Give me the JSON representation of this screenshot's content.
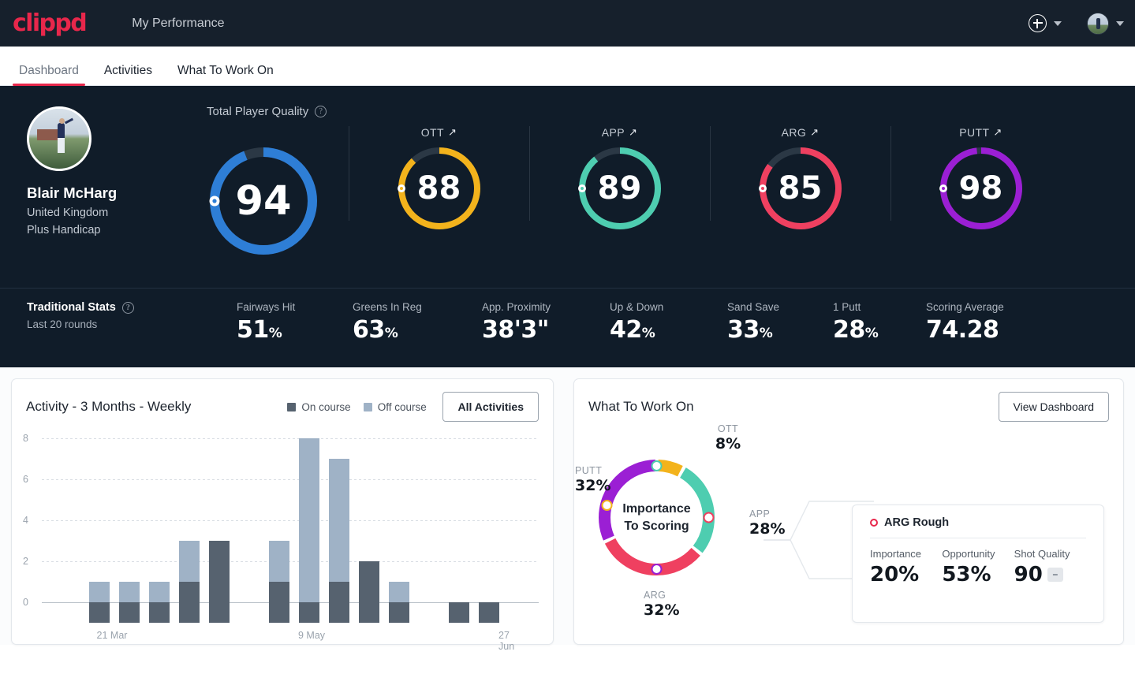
{
  "brand": {
    "logo_text": "clippd",
    "accent": "#e8274b"
  },
  "header": {
    "app_title": "My Performance",
    "add_icon": "plus-circle-icon",
    "add_caret": "chevron-down-icon",
    "avatar_caret": "chevron-down-icon"
  },
  "tabs": [
    {
      "label": "Dashboard",
      "active": true
    },
    {
      "label": "Activities",
      "active": false
    },
    {
      "label": "What To Work On",
      "active": false
    }
  ],
  "profile": {
    "name": "Blair McHarg",
    "country": "United Kingdom",
    "handicap": "Plus Handicap"
  },
  "quality": {
    "section_label": "Total Player Quality",
    "help_icon": "question-mark-icon",
    "total": {
      "label": "Total Player Quality",
      "value": "94",
      "percent": 94,
      "color": "#2e7ed6"
    },
    "skills": [
      {
        "label": "OTT",
        "trend": "↗",
        "value": "88",
        "percent": 88,
        "color": "#f3b31c"
      },
      {
        "label": "APP",
        "trend": "↗",
        "value": "89",
        "percent": 89,
        "color": "#4ecdb0"
      },
      {
        "label": "ARG",
        "trend": "↗",
        "value": "85",
        "percent": 85,
        "color": "#ef4060"
      },
      {
        "label": "PUTT",
        "trend": "↗",
        "value": "98",
        "percent": 98,
        "color": "#9b1fd4"
      }
    ]
  },
  "traditional": {
    "title": "Traditional Stats",
    "help_icon": "question-mark-icon",
    "subtitle": "Last 20 rounds",
    "stats": [
      {
        "label": "Fairways Hit",
        "value": "51",
        "unit": "%"
      },
      {
        "label": "Greens In Reg",
        "value": "63",
        "unit": "%"
      },
      {
        "label": "App. Proximity",
        "value": "38'3\"",
        "unit": ""
      },
      {
        "label": "Up & Down",
        "value": "42",
        "unit": "%"
      },
      {
        "label": "Sand Save",
        "value": "33",
        "unit": "%"
      },
      {
        "label": "1 Putt",
        "value": "28",
        "unit": "%"
      },
      {
        "label": "Scoring Average",
        "value": "74.28",
        "unit": ""
      }
    ]
  },
  "activity": {
    "title": "Activity - 3 Months - Weekly",
    "legend": [
      {
        "label": "On course",
        "color": "#56626f"
      },
      {
        "label": "Off course",
        "color": "#9fb2c6"
      }
    ],
    "button": "All Activities"
  },
  "chart_data": {
    "type": "bar",
    "title": "Activity - 3 Months - Weekly",
    "stacked": true,
    "xlabel": "",
    "ylabel": "",
    "ylim": [
      0,
      9
    ],
    "yticks": [
      0,
      2,
      4,
      6,
      8
    ],
    "grid": true,
    "legend_position": "top-right",
    "categories": [
      "21 Mar",
      "28 Mar",
      "4 Apr",
      "11 Apr",
      "18 Apr",
      "25 Apr",
      "2 May",
      "9 May",
      "16 May",
      "23 May",
      "30 May",
      "6 Jun",
      "13 Jun",
      "20 Jun",
      "27 Jun",
      "4 Jul"
    ],
    "xtick_labels": [
      {
        "category": "21 Mar",
        "index": 0
      },
      {
        "category": "9 May",
        "index": 7
      },
      {
        "category": "27 Jun",
        "index": 14
      }
    ],
    "series": [
      {
        "name": "On course",
        "color": "#56626f",
        "values": [
          1,
          1,
          1,
          2,
          4,
          0,
          2,
          1,
          2,
          3,
          1,
          0,
          1,
          1,
          0,
          0
        ]
      },
      {
        "name": "Off course",
        "color": "#9fb2c6",
        "values": [
          1,
          1,
          1,
          2,
          0,
          0,
          2,
          8,
          6,
          0,
          1,
          0,
          0,
          0,
          0,
          0
        ]
      }
    ]
  },
  "wtwo": {
    "title": "What To Work On",
    "button": "View Dashboard",
    "donut_center_line1": "Importance",
    "donut_center_line2": "To Scoring",
    "segments": [
      {
        "label": "OTT",
        "value": "8%",
        "percent": 8,
        "color": "#f3b31c"
      },
      {
        "label": "APP",
        "value": "28%",
        "percent": 28,
        "color": "#4ecdb0"
      },
      {
        "label": "ARG",
        "value": "32%",
        "percent": 32,
        "color": "#ef4060"
      },
      {
        "label": "PUTT",
        "value": "32%",
        "percent": 32,
        "color": "#9b1fd4"
      }
    ],
    "detail": {
      "marker_icon": "ring-marker-icon",
      "title": "ARG Rough",
      "metrics": [
        {
          "label": "Importance",
          "value": "20%"
        },
        {
          "label": "Opportunity",
          "value": "53%"
        },
        {
          "label": "Shot Quality",
          "value": "90",
          "badge": "–"
        }
      ]
    }
  }
}
